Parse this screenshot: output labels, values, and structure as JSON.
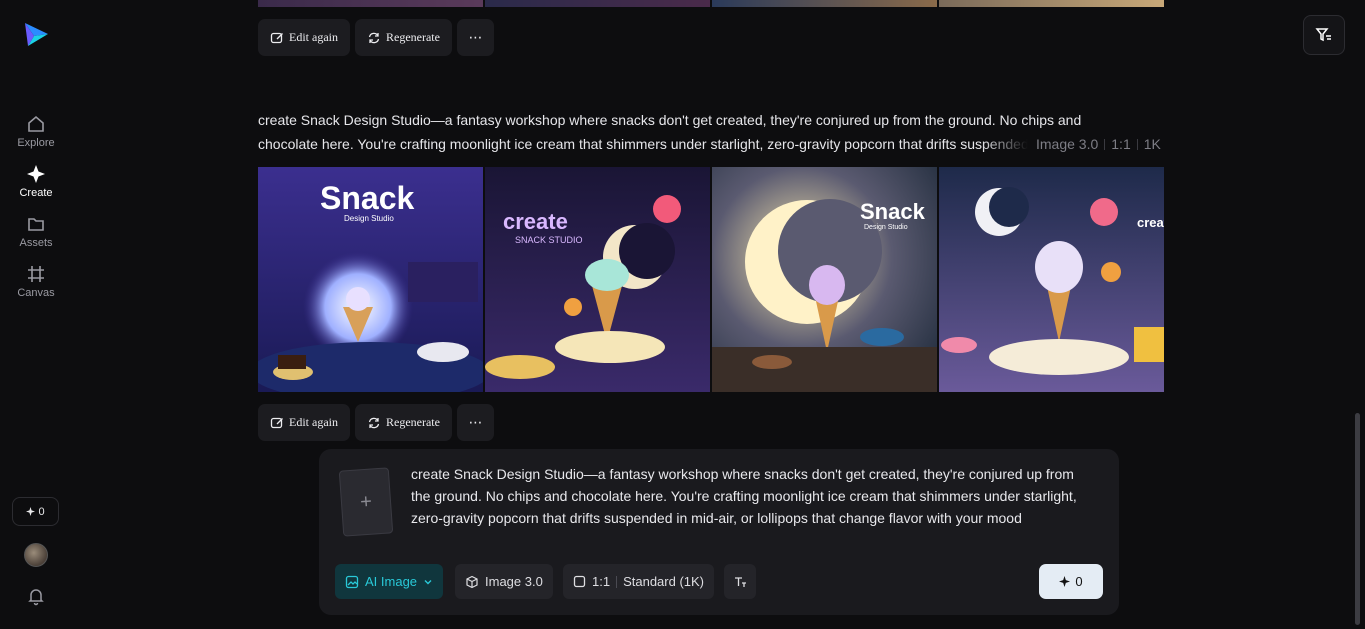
{
  "sidebar": {
    "items": [
      {
        "label": "Explore",
        "icon": "home-icon"
      },
      {
        "label": "Create",
        "icon": "sparkle-icon"
      },
      {
        "label": "Assets",
        "icon": "folder-icon"
      },
      {
        "label": "Canvas",
        "icon": "grid-icon"
      }
    ],
    "credits": "0"
  },
  "actions": {
    "edit_again": "Edit again",
    "regenerate": "Regenerate",
    "more": "⋯"
  },
  "generation": {
    "prompt_line1": "create Snack Design Studio—a fantasy workshop where snacks don't get created, they're conjured up from the ground. No chips and",
    "prompt_line2": "chocolate here. You're crafting moonlight ice cream that shimmers under starlight, zero-gravity popcorn that drifts suspended in mid-air, or lollipops that change flavor with your mood",
    "model": "Image 3.0",
    "ratio": "1:1",
    "resolution": "1K",
    "images": [
      {
        "title": "Snack",
        "subtitle": "Design Studio"
      },
      {
        "title": "create",
        "subtitle": "SNACK STUDIO"
      },
      {
        "title": "Snack",
        "subtitle": "Design Studio"
      },
      {
        "title": "create",
        "subtitle": ""
      }
    ]
  },
  "composer": {
    "text_lines": [
      "create Snack Design Studio—a fantasy workshop where snacks don't get created, they're conjured up from",
      "the ground. No chips and chocolate here. You're crafting moonlight ice cream that shimmers under starlight,",
      "zero-gravity popcorn that drifts suspended in mid-air, or lollipops that change flavor with your mood"
    ],
    "add_reference": "+",
    "mode": "AI Image",
    "model": "Image 3.0",
    "ratio": "1:1",
    "quality": "Standard (1K)",
    "send_count": "0"
  },
  "colors": {
    "background": "#0d0d0f",
    "accent": "#29c9d8",
    "button": "#1c1c20"
  }
}
